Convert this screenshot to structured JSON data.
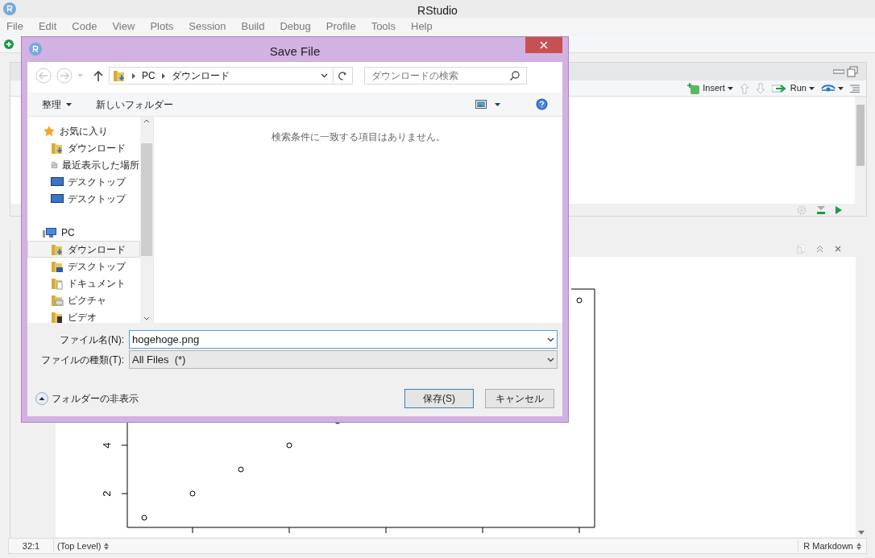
{
  "app": {
    "title": "RStudio",
    "menu": [
      "File",
      "Edit",
      "Code",
      "View",
      "Plots",
      "Session",
      "Build",
      "Debug",
      "Profile",
      "Tools",
      "Help"
    ]
  },
  "editor": {
    "toolbar": [
      {
        "kind": "insert",
        "label": "Insert"
      },
      {
        "kind": "run",
        "label": "Run"
      }
    ]
  },
  "plot": {
    "y_tick_labels": [
      "2",
      "4"
    ]
  },
  "status_bar": {
    "position": "32:1",
    "scope": "(Top Level)",
    "mode": "R Markdown"
  },
  "dialog": {
    "title": "Save File",
    "breadcrumb": [
      "PC",
      "ダウンロード"
    ],
    "search": {
      "placeholder": "ダウンロードの検索"
    },
    "toolbar": [
      {
        "label": "整理",
        "menu": true
      },
      {
        "label": "新しいフォルダー",
        "menu": false
      }
    ],
    "nav": [
      {
        "label": "お気に入り",
        "kind": "star",
        "selected": false,
        "children": [
          {
            "label": "ダウンロード",
            "kind": "download",
            "selected": false
          },
          {
            "label": "最近表示した場所",
            "kind": "recent",
            "selected": false
          },
          {
            "label": "デスクトップ",
            "kind": "desktop",
            "selected": false
          },
          {
            "label": "デスクトップ",
            "kind": "desktop",
            "selected": false
          }
        ]
      },
      {
        "label": "PC",
        "kind": "pc",
        "selected": false,
        "children": [
          {
            "label": "ダウンロード",
            "kind": "download",
            "selected": true
          },
          {
            "label": "デスクトップ",
            "kind": "folder-desktop",
            "selected": false
          },
          {
            "label": "ドキュメント",
            "kind": "documents",
            "selected": false
          },
          {
            "label": "ピクチャ",
            "kind": "pictures",
            "selected": false
          },
          {
            "label": "ビデオ",
            "kind": "videos",
            "selected": false
          }
        ]
      }
    ],
    "empty_message": "検索条件に一致する項目はありません。",
    "filename": {
      "label": "ファイル名(N):",
      "value": "hogehoge.png"
    },
    "filetype": {
      "label": "ファイルの種類(T):",
      "value": "All Files  (*)"
    },
    "toggle": "フォルダーの非表示",
    "buttons": [
      {
        "label": "保存(S)",
        "default": true
      },
      {
        "label": "キャンセル",
        "default": false
      }
    ]
  }
}
